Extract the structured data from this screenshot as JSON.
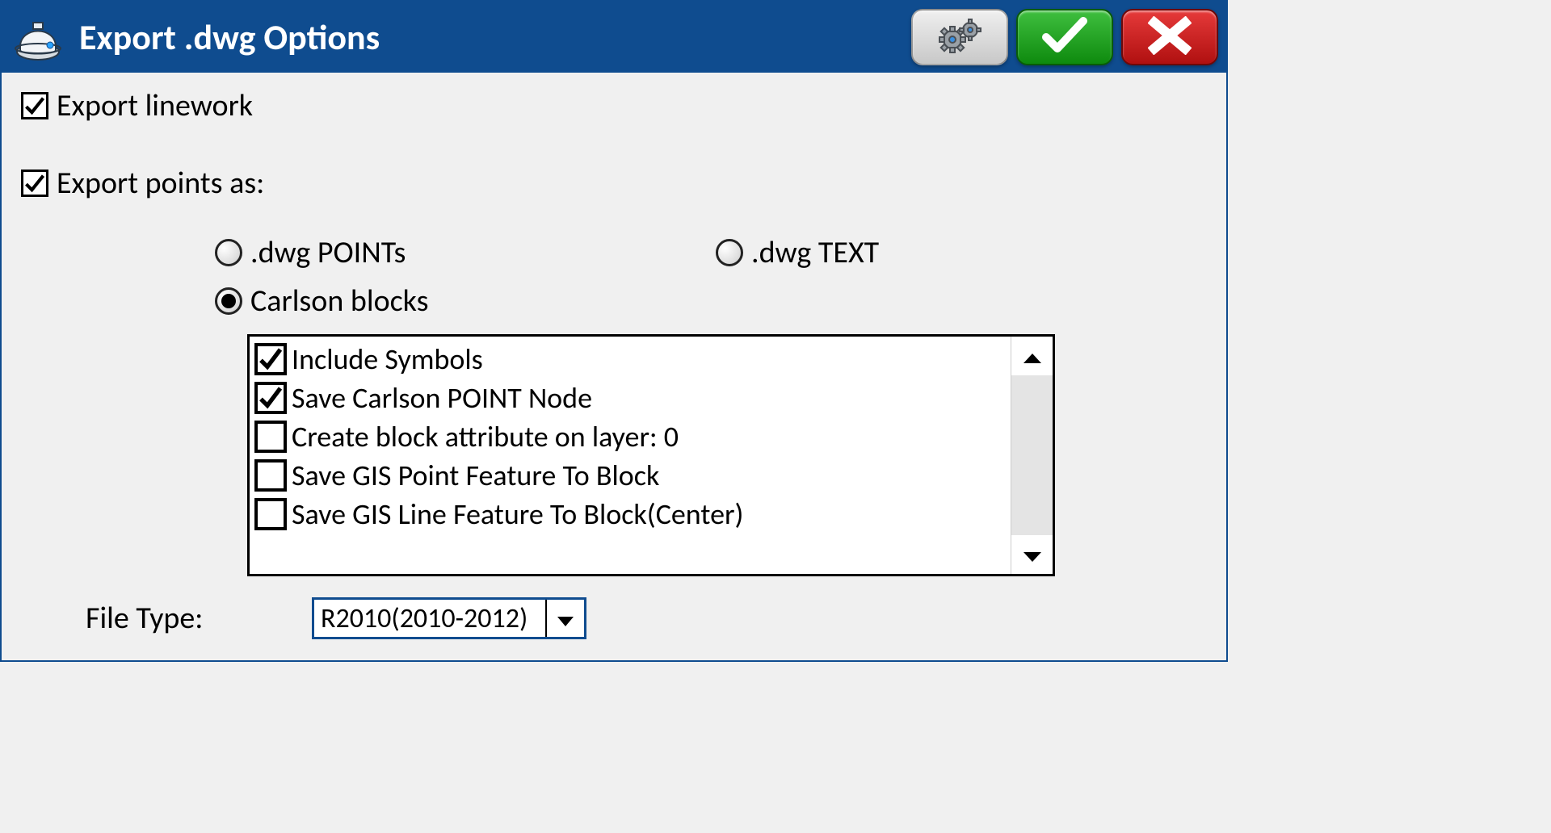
{
  "titlebar": {
    "title": "Export .dwg Options"
  },
  "options": {
    "export_linework": {
      "label": "Export linework",
      "checked": true
    },
    "export_points_as": {
      "label": "Export points as:",
      "checked": true
    }
  },
  "radios": {
    "dwg_points": {
      "label": ".dwg POINTs",
      "selected": false
    },
    "dwg_text": {
      "label": ".dwg TEXT",
      "selected": false
    },
    "carlson_blocks": {
      "label": "Carlson blocks",
      "selected": true
    }
  },
  "list": {
    "items": [
      {
        "label": "Include Symbols",
        "checked": true
      },
      {
        "label": "Save Carlson POINT Node",
        "checked": true
      },
      {
        "label": "Create block attribute on layer: 0",
        "checked": false
      },
      {
        "label": "Save GIS Point Feature To Block",
        "checked": false
      },
      {
        "label": "Save GIS Line Feature To Block(Center)",
        "checked": false
      }
    ]
  },
  "filetype": {
    "label": "File Type:",
    "value": "R2010(2010-2012)"
  }
}
